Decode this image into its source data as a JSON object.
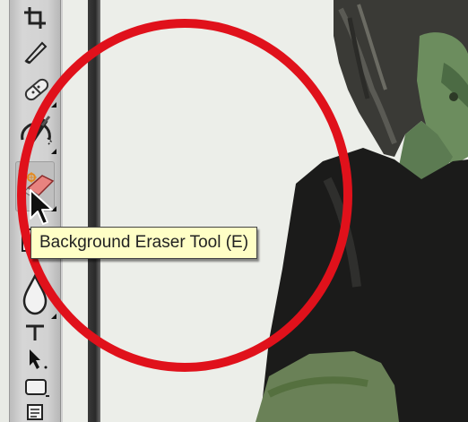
{
  "app": {
    "accent_color": "#e0111b",
    "tooltip_background": "#ffffc6"
  },
  "toolbox": {
    "tools": [
      {
        "name": "crop-icon",
        "has_flyout": false
      },
      {
        "name": "slice-icon",
        "has_flyout": false
      },
      {
        "name": "healing-brush-icon",
        "has_flyout": true
      },
      {
        "name": "history-brush-icon",
        "has_flyout": true
      },
      {
        "name": "background-eraser-icon",
        "has_flyout": true,
        "active": true
      },
      {
        "name": "gradient-icon",
        "has_flyout": false
      },
      {
        "name": "blur-drop-icon",
        "has_flyout": true
      },
      {
        "name": "type-icon",
        "has_flyout": false
      },
      {
        "name": "path-selection-icon",
        "has_flyout": false
      },
      {
        "name": "shape-icon",
        "has_flyout": false
      },
      {
        "name": "notes-icon",
        "has_flyout": false
      }
    ]
  },
  "tooltip": {
    "text": "Background Eraser Tool (E)"
  },
  "cursor": {
    "icon": "arrow-pointer-icon"
  }
}
